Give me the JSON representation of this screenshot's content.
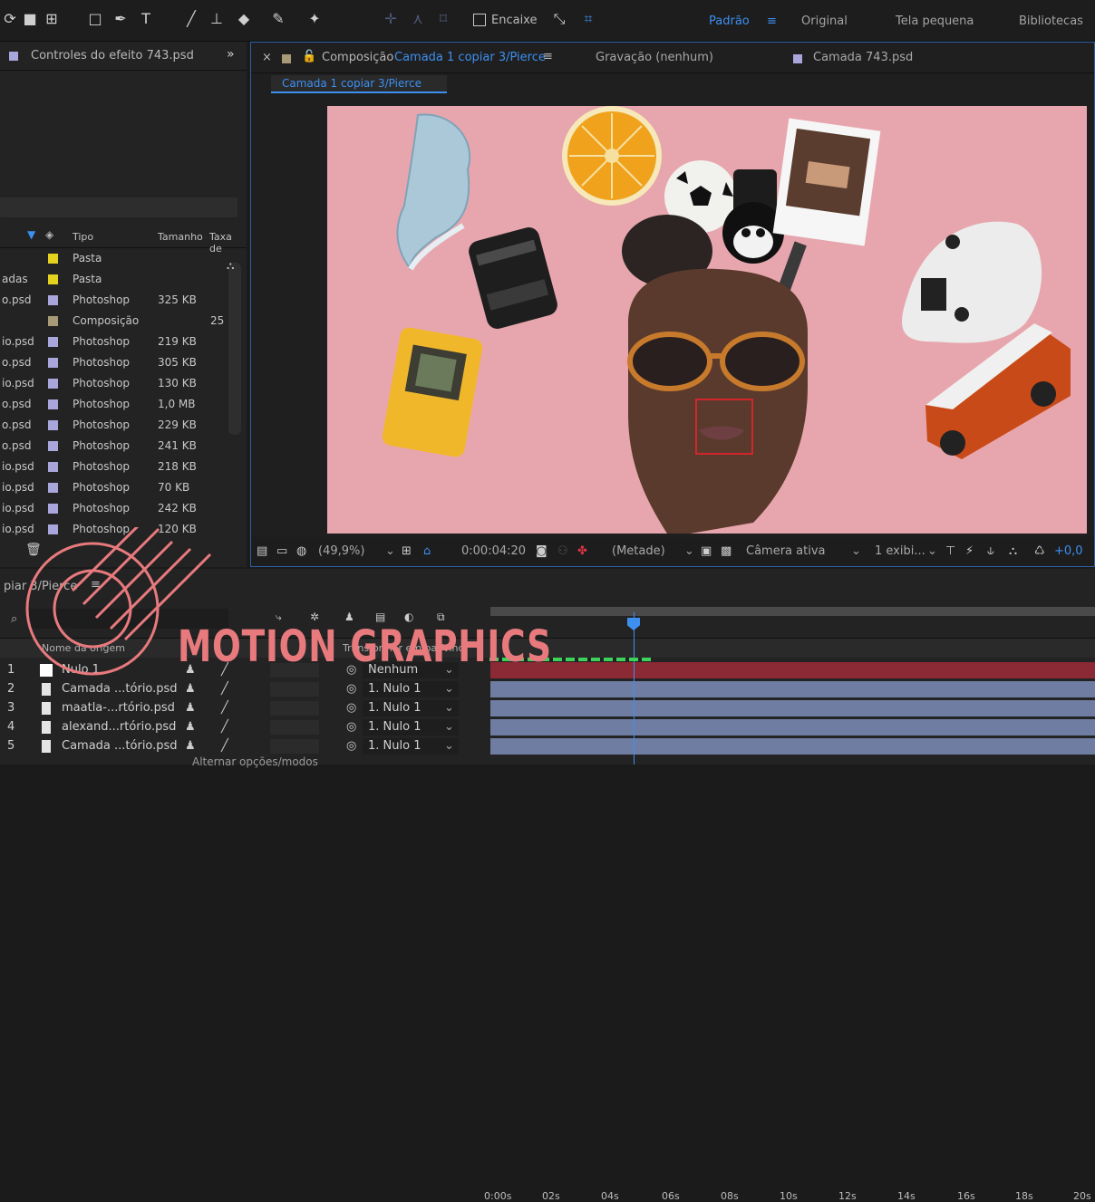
{
  "toolbar": {
    "snap_label": "Encaixe",
    "workspaces": [
      "Padrão",
      "Original",
      "Tela pequena",
      "Bibliotecas"
    ],
    "active_workspace": "Padrão"
  },
  "left_panel": {
    "tab_label": "Controles do efeito 743.psd",
    "expand_glyph": "»",
    "columns": {
      "type": "Tipo",
      "size": "Tamanho",
      "rate": "Taxa de"
    },
    "rows": [
      {
        "name": "",
        "color": "#e5d21f",
        "type": "Pasta",
        "size": ""
      },
      {
        "name": "adas",
        "color": "#e5d21f",
        "type": "Pasta",
        "size": ""
      },
      {
        "name": "o.psd",
        "color": "#a9a6dc",
        "type": "Photoshop",
        "size": "325 KB"
      },
      {
        "name": "",
        "color": "#a89a76",
        "type": "Composição",
        "size": "",
        "rate": "25"
      },
      {
        "name": "io.psd",
        "color": "#a9a6dc",
        "type": "Photoshop",
        "size": "219 KB"
      },
      {
        "name": "o.psd",
        "color": "#a9a6dc",
        "type": "Photoshop",
        "size": "305 KB"
      },
      {
        "name": "io.psd",
        "color": "#a9a6dc",
        "type": "Photoshop",
        "size": "130 KB"
      },
      {
        "name": "o.psd",
        "color": "#a9a6dc",
        "type": "Photoshop",
        "size": "1,0 MB"
      },
      {
        "name": "o.psd",
        "color": "#a9a6dc",
        "type": "Photoshop",
        "size": "229 KB"
      },
      {
        "name": "o.psd",
        "color": "#a9a6dc",
        "type": "Photoshop",
        "size": "241 KB"
      },
      {
        "name": "io.psd",
        "color": "#a9a6dc",
        "type": "Photoshop",
        "size": "218 KB"
      },
      {
        "name": "io.psd",
        "color": "#a9a6dc",
        "type": "Photoshop",
        "size": "70 KB"
      },
      {
        "name": "io.psd",
        "color": "#a9a6dc",
        "type": "Photoshop",
        "size": "242 KB"
      },
      {
        "name": "io.psd",
        "color": "#a9a6dc",
        "type": "Photoshop",
        "size": "120 KB"
      }
    ]
  },
  "composition": {
    "tab_prefix": "Composição",
    "tab_name": "Camada 1 copiar 3/Pierce",
    "recording": "Gravação (nenhum)",
    "layer_tab": "Camada 743.psd",
    "breadcrumb": "Camada 1 copiar 3/Pierce",
    "zoom": "(49,9%)",
    "timecode": "0:00:04:20",
    "resolution": "(Metade)",
    "camera": "Câmera ativa",
    "views": "1 exibi...",
    "exposure": "+0,0"
  },
  "timeline": {
    "tab": "piar 3/Pierce",
    "col_source": "Nome da origem",
    "col_parent": "Transformar em pai/vinc.",
    "ruler": [
      "0:00s",
      "02s",
      "04s",
      "06s",
      "08s",
      "10s",
      "12s",
      "14s",
      "16s",
      "18s",
      "20s"
    ],
    "layers": [
      {
        "num": "1",
        "name": "Nulo 1",
        "parent": "Nenhum"
      },
      {
        "num": "2",
        "name": "Camada ...tório.psd",
        "parent": "1. Nulo 1"
      },
      {
        "num": "3",
        "name": "maatla-...rtório.psd",
        "parent": "1. Nulo 1"
      },
      {
        "num": "4",
        "name": "alexand...rtório.psd",
        "parent": "1. Nulo 1"
      },
      {
        "num": "5",
        "name": "Camada ...tório.psd",
        "parent": "1. Nulo 1"
      }
    ],
    "footer": "Alternar opções/modos"
  },
  "watermark": "MOTION GRAPHICS",
  "colors": {
    "accent": "#3d8ff0",
    "canvas": "#e7a6ad",
    "null_track": "#8b2a34",
    "layer_track": "#6f7da3",
    "watermark": "#e87a7e"
  }
}
